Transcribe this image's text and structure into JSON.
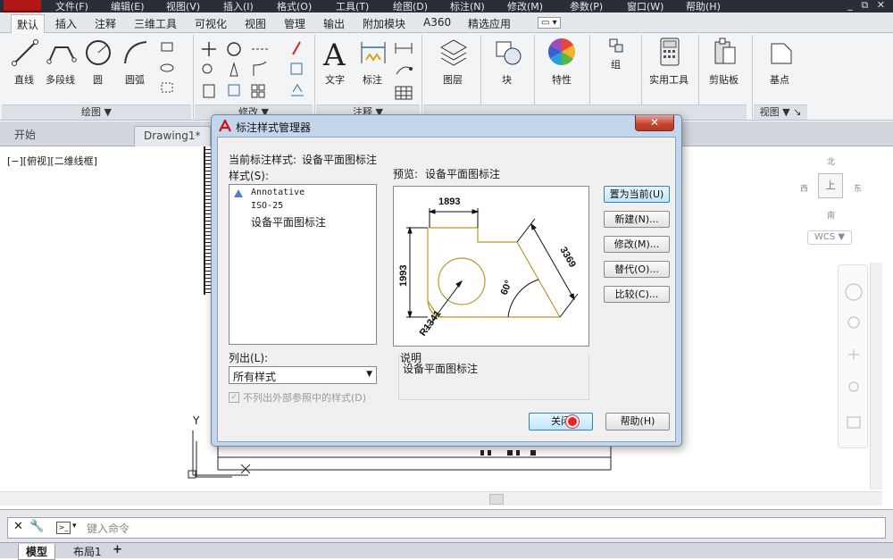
{
  "menu": {
    "items": [
      "文件(F)",
      "编辑(E)",
      "视图(V)",
      "插入(I)",
      "格式(O)",
      "工具(T)",
      "绘图(D)",
      "标注(N)",
      "修改(M)",
      "参数(P)",
      "窗口(W)",
      "帮助(H)"
    ]
  },
  "ribbon": {
    "tabs": [
      "默认",
      "插入",
      "注释",
      "三维工具",
      "可视化",
      "视图",
      "管理",
      "输出",
      "附加模块",
      "A360",
      "精选应用"
    ],
    "tools": {
      "line": "直线",
      "polyline": "多段线",
      "circle": "圆",
      "arc": "圆弧",
      "text": "文字",
      "dimension": "标注",
      "layers": "图层",
      "block": "块",
      "properties": "特性",
      "group": "组",
      "utilities": "实用工具",
      "clipboard": "剪贴板",
      "basepoint": "基点"
    },
    "panels": {
      "draw": "绘图 ▼",
      "modify": "修改 ▼",
      "annotation": "注释 ▼",
      "view": "视图 ▼ ↘"
    }
  },
  "doc_tabs": [
    "开始",
    "Drawing1*"
  ],
  "viewport_label": "[−][俯视][二维线框]",
  "viewcube": {
    "north": "北",
    "south": "南",
    "east": "东",
    "west": "西",
    "top": "上",
    "wcs": "WCS ▼"
  },
  "command_placeholder": "键入命令",
  "layout_tabs": [
    "模型",
    "布局1",
    "+"
  ],
  "ucs": {
    "y": "Y"
  },
  "dialog": {
    "title": "标注样式管理器",
    "current_style_label": "当前标注样式:",
    "current_style": "设备平面图标注",
    "styles_label": "样式(S):",
    "styles": [
      "Annotative",
      "ISO-25",
      "设备平面图标注"
    ],
    "preview_label": "预览:",
    "preview_name": "设备平面图标注",
    "list_label": "列出(L):",
    "list_value": "所有样式",
    "xref_checkbox": "不列出外部参照中的样式(D)",
    "description_label": "说明",
    "description": "设备平面图标注",
    "buttons": {
      "set_current": "置为当前(U)",
      "new": "新建(N)...",
      "modify": "修改(M)...",
      "override": "替代(O)...",
      "compare": "比较(C)...",
      "close": "关闭",
      "help": "帮助(H)"
    },
    "preview_dims": {
      "top": "1893",
      "left": "1993",
      "slant": "3369",
      "angle": "60°",
      "radius": "R1341"
    }
  },
  "colors": {
    "accent": "#b01818",
    "drawing": "#b89a2a",
    "titlebar": "#c4d6ec"
  }
}
